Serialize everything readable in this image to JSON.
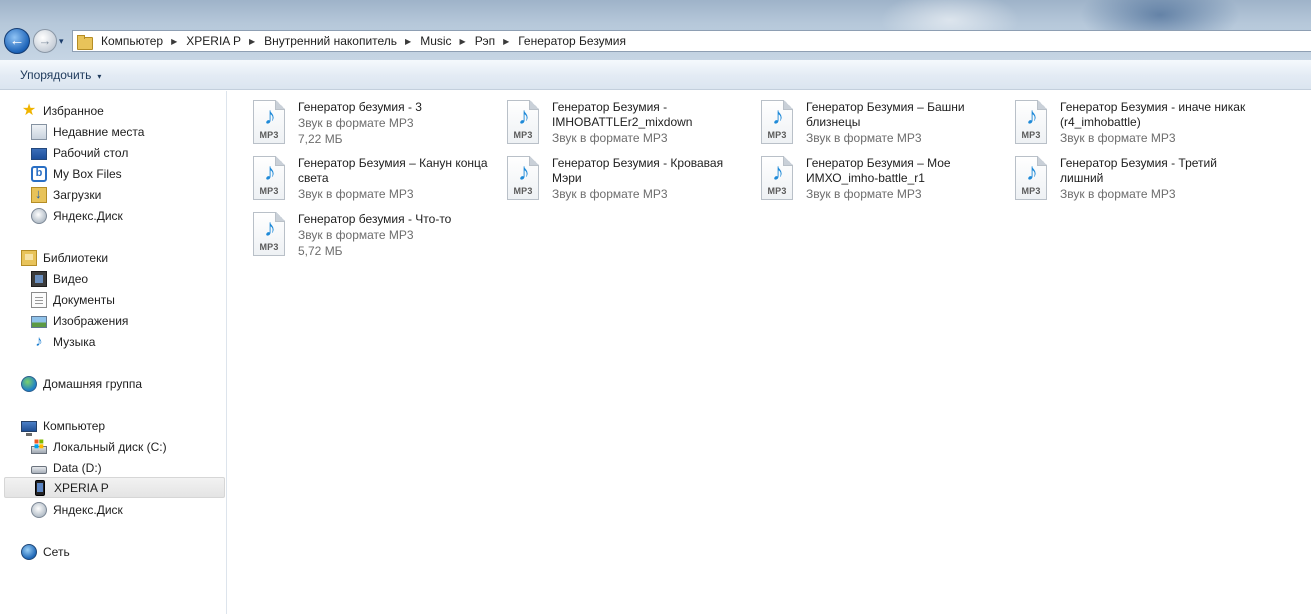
{
  "addressbar": {
    "back_glyph": "←",
    "forward_glyph": "→",
    "recent_glyph": "▾",
    "separator": "▶",
    "crumbs": [
      "Компьютер",
      "XPERIA P",
      "Внутренний накопитель",
      "Music",
      "Рэп",
      "Генератор Безумия"
    ]
  },
  "toolbar": {
    "organize_label": "Упорядочить",
    "organize_caret": "▾"
  },
  "sidebar": {
    "favorites": {
      "label": "Избранное",
      "items": [
        "Недавние места",
        "Рабочий стол",
        "My Box Files",
        "Загрузки",
        "Яндекс.Диск"
      ]
    },
    "libraries": {
      "label": "Библиотеки",
      "items": [
        "Видео",
        "Документы",
        "Изображения",
        "Музыка"
      ]
    },
    "homegroup": {
      "label": "Домашняя группа"
    },
    "computer": {
      "label": "Компьютер",
      "items": [
        "Локальный диск (C:)",
        "Data (D:)",
        "XPERIA P",
        "Яндекс.Диск"
      ]
    },
    "network": {
      "label": "Сеть"
    }
  },
  "icons": {
    "star": "★",
    "box": "b",
    "note": "♪",
    "mp3_label": "MP3"
  },
  "files": [
    {
      "name": "Генератор безумия - 3",
      "type": "Звук в формате MP3",
      "size": "7,22 МБ"
    },
    {
      "name": "Генератор Безумия - IMHOBATTLEr2_mixdown",
      "type": "Звук в формате MP3",
      "size": ""
    },
    {
      "name": "Генератор Безумия – Башни близнецы",
      "type": "Звук в формате MP3",
      "size": ""
    },
    {
      "name": "Генератор Безумия - иначе никак (r4_imhobattle)",
      "type": "Звук в формате MP3",
      "size": ""
    },
    {
      "name": "Генератор Безумия – Канун конца света",
      "type": "Звук в формате MP3",
      "size": ""
    },
    {
      "name": "Генератор Безумия - Кровавая Мэри",
      "type": "Звук в формате MP3",
      "size": ""
    },
    {
      "name": "Генератор Безумия – Мое ИМХО_imho-battle_r1",
      "type": "Звук в формате MP3",
      "size": ""
    },
    {
      "name": "Генератор Безумия - Третий лишний",
      "type": "Звук в формате MP3",
      "size": ""
    },
    {
      "name": "Генератор безумия - Что-то",
      "type": "Звук в формате MP3",
      "size": "5,72 МБ"
    }
  ]
}
